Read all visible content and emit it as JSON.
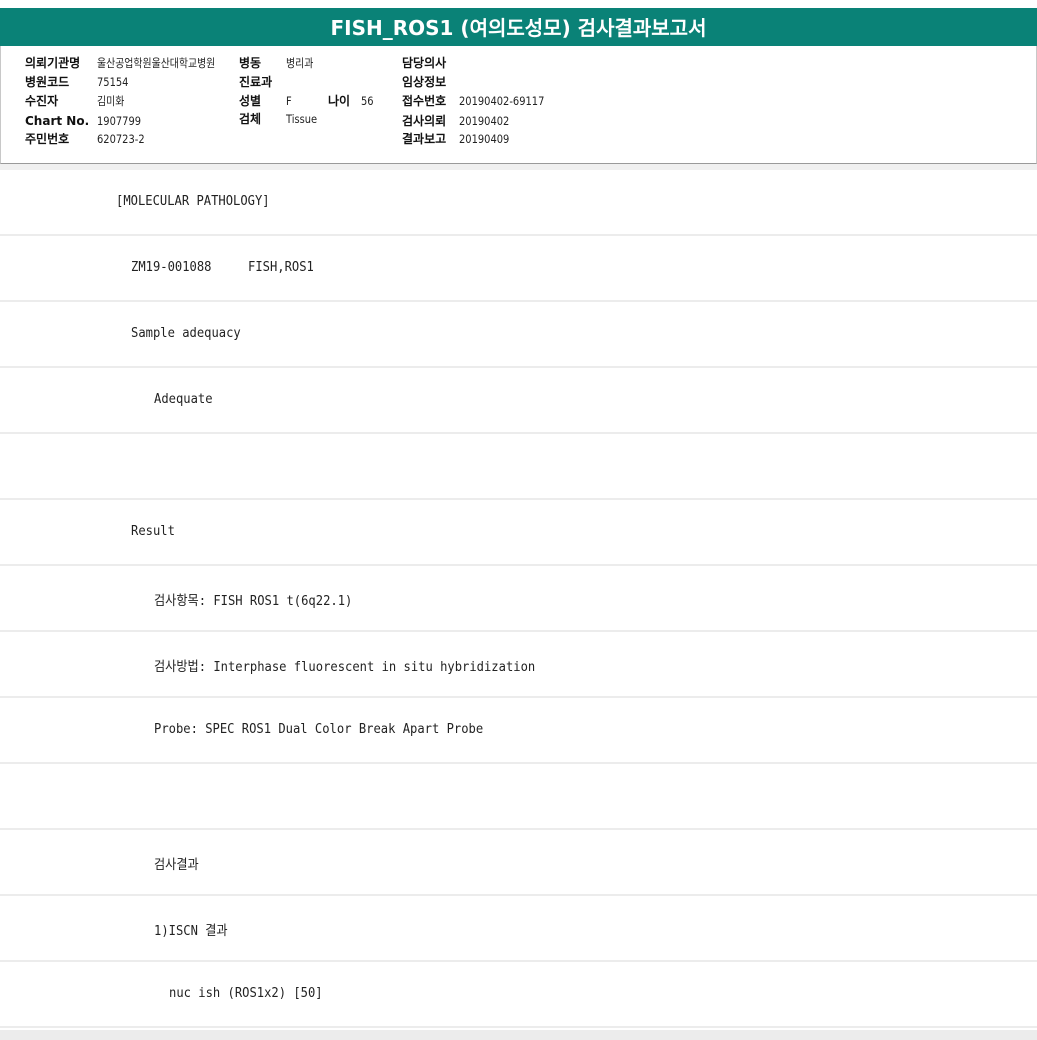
{
  "report": {
    "title": "FISH_ROS1 (여의도성모) 검사결과보고서"
  },
  "header": {
    "institution_label": "의뢰기관명",
    "institution_value": "울산공업학원울산대학교병원",
    "ward_label": "병동",
    "ward_value": "병리과",
    "doctor_label": "담당의사",
    "doctor_value": "",
    "hospital_code_label": "병원코드",
    "hospital_code_value": "75154",
    "department_label": "진료과",
    "department_value": "",
    "clinical_info_label": "임상정보",
    "clinical_info_value": "",
    "patient_label": "수진자",
    "patient_value": "김미화",
    "sex_label": "성별",
    "sex_value": "F",
    "age_label": "나이",
    "age_value": "56",
    "receipt_no_label": "접수번호",
    "receipt_no_value": "20190402-69117",
    "chart_no_label": "Chart No.",
    "chart_no_value": "1907799",
    "specimen_label": "검체",
    "specimen_value": "Tissue",
    "request_date_label": "검사의뢰",
    "request_date_value": "20190402",
    "resident_no_label": "주민번호",
    "resident_no_value": "620723-2",
    "report_date_label": "결과보고",
    "report_date_value": "20190409"
  },
  "lines": [
    "[MOLECULAR PATHOLOGY]",
    "ZM19-001088     FISH,ROS1",
    "Sample adequacy",
    "Adequate",
    "",
    "Result",
    "검사항목: FISH ROS1 t(6q22.1)",
    "검사방법: Interphase fluorescent in situ hybridization",
    "Probe: SPEC ROS1 Dual Color Break Apart Probe",
    "",
    "검사결과",
    "1)ISCN 결과",
    "nuc ish (ROS1x2) [50]"
  ]
}
